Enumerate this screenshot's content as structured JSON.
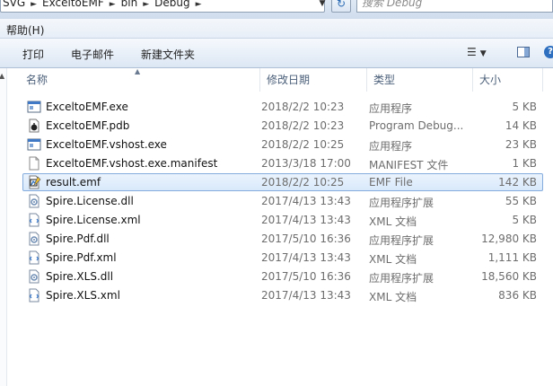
{
  "address": {
    "crumbs": [
      "SVG",
      "ExceltoEMF",
      "bin",
      "Debug"
    ],
    "search_placeholder": "搜索 Debug"
  },
  "menu": {
    "help": "帮助(H)"
  },
  "toolbar": {
    "print": "打印",
    "email": "电子邮件",
    "new_folder": "新建文件夹"
  },
  "columns": {
    "name": "名称",
    "date": "修改日期",
    "type": "类型",
    "size": "大小"
  },
  "files": [
    {
      "name": "ExceltoEMF.exe",
      "date": "2018/2/2 10:23",
      "type": "应用程序",
      "size": "5 KB",
      "icon": "exe-icon"
    },
    {
      "name": "ExceltoEMF.pdb",
      "date": "2018/2/2 10:23",
      "type": "Program Debug...",
      "size": "14 KB",
      "icon": "pdb-icon"
    },
    {
      "name": "ExceltoEMF.vshost.exe",
      "date": "2018/2/2 10:25",
      "type": "应用程序",
      "size": "23 KB",
      "icon": "exe-icon"
    },
    {
      "name": "ExceltoEMF.vshost.exe.manifest",
      "date": "2013/3/18 17:00",
      "type": "MANIFEST 文件",
      "size": "1 KB",
      "icon": "file-icon"
    },
    {
      "name": "result.emf",
      "date": "2018/2/2 10:25",
      "type": "EMF File",
      "size": "142 KB",
      "icon": "emf-icon",
      "selected": true
    },
    {
      "name": "Spire.License.dll",
      "date": "2017/4/13 13:43",
      "type": "应用程序扩展",
      "size": "55 KB",
      "icon": "dll-icon"
    },
    {
      "name": "Spire.License.xml",
      "date": "2017/4/13 13:43",
      "type": "XML 文档",
      "size": "5 KB",
      "icon": "xml-icon"
    },
    {
      "name": "Spire.Pdf.dll",
      "date": "2017/5/10 16:36",
      "type": "应用程序扩展",
      "size": "12,980 KB",
      "icon": "dll-icon"
    },
    {
      "name": "Spire.Pdf.xml",
      "date": "2017/4/13 13:43",
      "type": "XML 文档",
      "size": "1,111 KB",
      "icon": "xml-icon"
    },
    {
      "name": "Spire.XLS.dll",
      "date": "2017/5/10 16:36",
      "type": "应用程序扩展",
      "size": "18,560 KB",
      "icon": "dll-icon"
    },
    {
      "name": "Spire.XLS.xml",
      "date": "2017/4/13 13:43",
      "type": "XML 文档",
      "size": "836 KB",
      "icon": "xml-icon"
    }
  ]
}
